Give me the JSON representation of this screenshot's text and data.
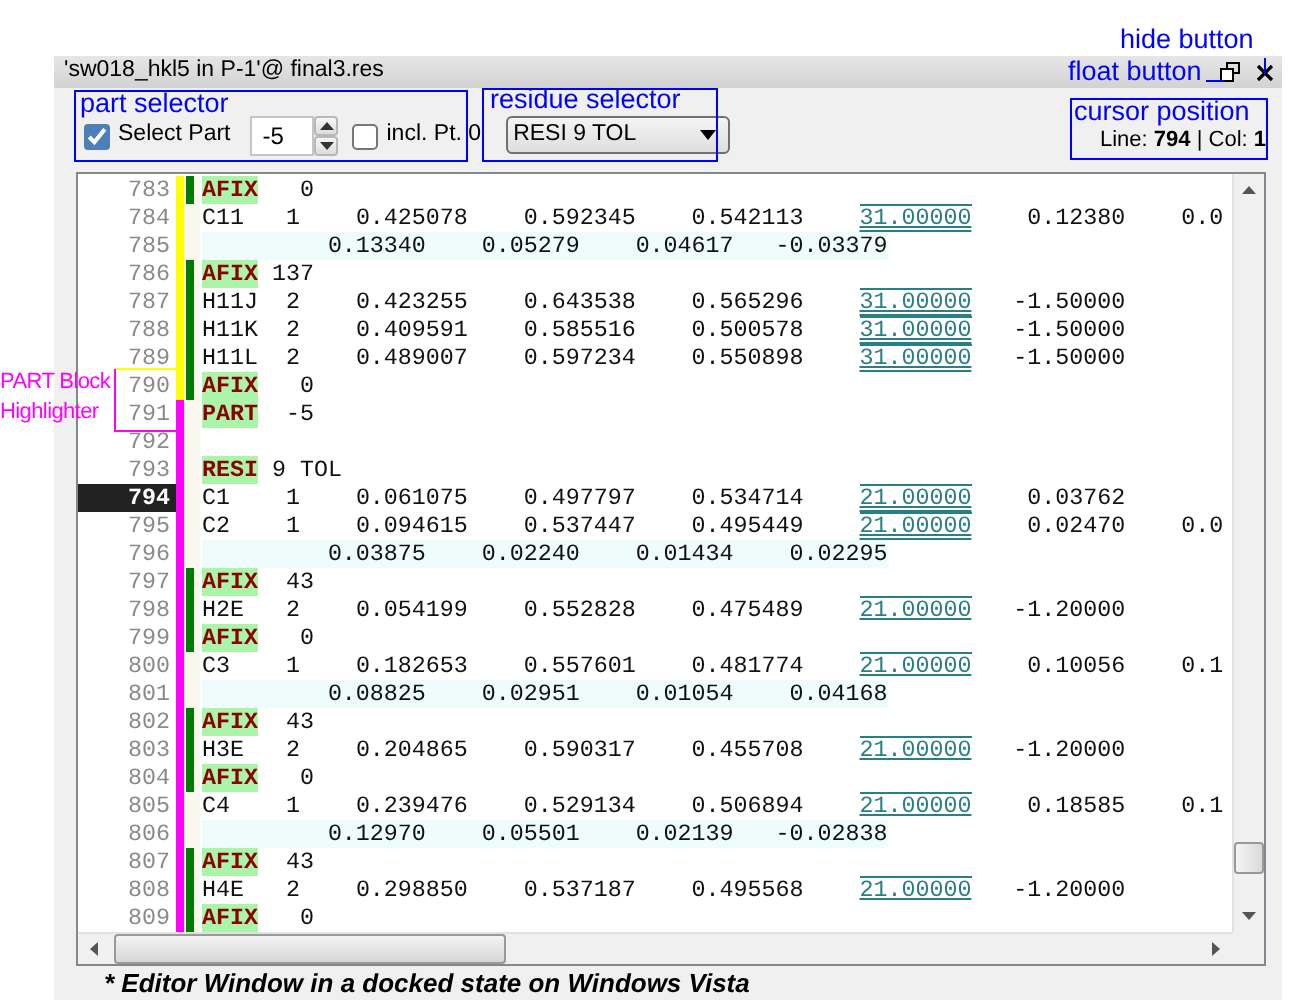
{
  "window": {
    "title": "'sw018_hkl5 in P-1'@ final3.res"
  },
  "toolbar": {
    "select_part": {
      "label": "Select Part",
      "checked": true
    },
    "part_number": "-5",
    "include_part0": {
      "label": "incl. Pt. 0",
      "checked": false
    },
    "residue": "RESI 9 TOL",
    "cursor_position": "Line: **794** | Col: **1**"
  },
  "lines": [
    {
      "number": "783",
      "kind": "instruction",
      "color": "#ffff00",
      "afix_bar": true,
      "selected": false,
      "keyword": "AFIX",
      "args": "   0"
    },
    {
      "number": "784",
      "kind": "atom",
      "color": "#ffff00",
      "afix_bar": false,
      "selected": false,
      "double_underline": true,
      "cells": [
        "C11",
        "1",
        "0.425078",
        "0.592345",
        "0.542113",
        "31.00000",
        "0.12380",
        "0.0"
      ]
    },
    {
      "number": "785",
      "kind": "continuation",
      "color": "#ffff00",
      "afix_bar": false,
      "selected": false,
      "cells": [
        "0.13340",
        "0.05279",
        "0.04617",
        "-0.03379"
      ]
    },
    {
      "number": "786",
      "kind": "instruction",
      "color": "#ffff00",
      "afix_bar": true,
      "selected": false,
      "keyword": "AFIX",
      "args": " 137"
    },
    {
      "number": "787",
      "kind": "atom",
      "color": "#ffff00",
      "afix_bar": true,
      "selected": false,
      "double_underline": true,
      "cells": [
        "H11J",
        "2",
        "0.423255",
        "0.643538",
        "0.565296",
        "31.00000",
        "-1.50000"
      ]
    },
    {
      "number": "788",
      "kind": "atom",
      "color": "#ffff00",
      "afix_bar": true,
      "selected": false,
      "double_underline": true,
      "cells": [
        "H11K",
        "2",
        "0.409591",
        "0.585516",
        "0.500578",
        "31.00000",
        "-1.50000"
      ]
    },
    {
      "number": "789",
      "kind": "atom",
      "color": "#ffff00",
      "afix_bar": true,
      "selected": false,
      "double_underline": true,
      "cells": [
        "H11L",
        "2",
        "0.489007",
        "0.597234",
        "0.550898",
        "31.00000",
        "-1.50000"
      ]
    },
    {
      "number": "790",
      "kind": "instruction",
      "color": "#ffff00",
      "afix_bar": true,
      "selected": false,
      "keyword": "AFIX",
      "args": "   0"
    },
    {
      "number": "791",
      "kind": "instruction",
      "color": "#ff00ff",
      "afix_bar": false,
      "selected": false,
      "keyword": "PART",
      "args": "  -5"
    },
    {
      "number": "792",
      "kind": "blank",
      "color": "#ff00ff",
      "afix_bar": false,
      "selected": false
    },
    {
      "number": "793",
      "kind": "instruction",
      "color": "#ff00ff",
      "afix_bar": false,
      "selected": false,
      "keyword": "RESI",
      "args": " 9 TOL"
    },
    {
      "number": "794",
      "kind": "atom",
      "color": "#ff00ff",
      "afix_bar": false,
      "selected": true,
      "double_underline": true,
      "cells": [
        "C1",
        "1",
        "0.061075",
        "0.497797",
        "0.534714",
        "21.00000",
        "0.03762"
      ]
    },
    {
      "number": "795",
      "kind": "atom",
      "color": "#ff00ff",
      "afix_bar": false,
      "selected": false,
      "double_underline": true,
      "cells": [
        "C2",
        "1",
        "0.094615",
        "0.537447",
        "0.495449",
        "21.00000",
        "0.02470",
        "0.0"
      ]
    },
    {
      "number": "796",
      "kind": "continuation",
      "color": "#ff00ff",
      "afix_bar": false,
      "selected": false,
      "cells": [
        "0.03875",
        "0.02240",
        "0.01434",
        "0.02295"
      ]
    },
    {
      "number": "797",
      "kind": "instruction",
      "color": "#ff00ff",
      "afix_bar": true,
      "selected": false,
      "keyword": "AFIX",
      "args": "  43"
    },
    {
      "number": "798",
      "kind": "atom",
      "color": "#ff00ff",
      "afix_bar": true,
      "selected": false,
      "double_underline": false,
      "cells": [
        "H2E",
        "2",
        "0.054199",
        "0.552828",
        "0.475489",
        "21.00000",
        "-1.20000"
      ]
    },
    {
      "number": "799",
      "kind": "instruction",
      "color": "#ff00ff",
      "afix_bar": true,
      "selected": false,
      "keyword": "AFIX",
      "args": "   0"
    },
    {
      "number": "800",
      "kind": "atom",
      "color": "#ff00ff",
      "afix_bar": false,
      "selected": false,
      "double_underline": false,
      "cells": [
        "C3",
        "1",
        "0.182653",
        "0.557601",
        "0.481774",
        "21.00000",
        "0.10056",
        "0.1"
      ]
    },
    {
      "number": "801",
      "kind": "continuation",
      "color": "#ff00ff",
      "afix_bar": false,
      "selected": false,
      "cells": [
        "0.08825",
        "0.02951",
        "0.01054",
        "0.04168"
      ]
    },
    {
      "number": "802",
      "kind": "instruction",
      "color": "#ff00ff",
      "afix_bar": true,
      "selected": false,
      "keyword": "AFIX",
      "args": "  43"
    },
    {
      "number": "803",
      "kind": "atom",
      "color": "#ff00ff",
      "afix_bar": true,
      "selected": false,
      "double_underline": false,
      "cells": [
        "H3E",
        "2",
        "0.204865",
        "0.590317",
        "0.455708",
        "21.00000",
        "-1.20000"
      ]
    },
    {
      "number": "804",
      "kind": "instruction",
      "color": "#ff00ff",
      "afix_bar": true,
      "selected": false,
      "keyword": "AFIX",
      "args": "   0"
    },
    {
      "number": "805",
      "kind": "atom",
      "color": "#ff00ff",
      "afix_bar": false,
      "selected": false,
      "double_underline": false,
      "cells": [
        "C4",
        "1",
        "0.239476",
        "0.529134",
        "0.506894",
        "21.00000",
        "0.18585",
        "0.1"
      ]
    },
    {
      "number": "806",
      "kind": "continuation",
      "color": "#ff00ff",
      "afix_bar": false,
      "selected": false,
      "cells": [
        "0.12970",
        "0.05501",
        "0.02139",
        "-0.02838"
      ]
    },
    {
      "number": "807",
      "kind": "instruction",
      "color": "#ff00ff",
      "afix_bar": true,
      "selected": false,
      "keyword": "AFIX",
      "args": "  43"
    },
    {
      "number": "808",
      "kind": "atom",
      "color": "#ff00ff",
      "afix_bar": true,
      "selected": false,
      "double_underline": false,
      "cells": [
        "H4E",
        "2",
        "0.298850",
        "0.537187",
        "0.495568",
        "21.00000",
        "-1.20000"
      ]
    },
    {
      "number": "809",
      "kind": "instruction",
      "color": "#ff00ff",
      "afix_bar": true,
      "selected": false,
      "keyword": "AFIX",
      "args": "   0"
    }
  ],
  "caption": "* Editor Window in a docked state on Windows Vista",
  "annotations": [
    {
      "kind": "leader",
      "text": "hide button",
      "color": "#0000ff"
    },
    {
      "kind": "leader",
      "text": "float button",
      "color": "#0000ff"
    },
    {
      "kind": "box",
      "text": "part selector",
      "color": "#0000ff"
    },
    {
      "kind": "box",
      "text": "residue selector",
      "color": "#0000ff"
    },
    {
      "kind": "box",
      "text": "cursor position",
      "color": "#0000ff"
    },
    {
      "kind": "bracket",
      "text": "PART Block Highlighter",
      "color": "#ff00ff"
    }
  ]
}
